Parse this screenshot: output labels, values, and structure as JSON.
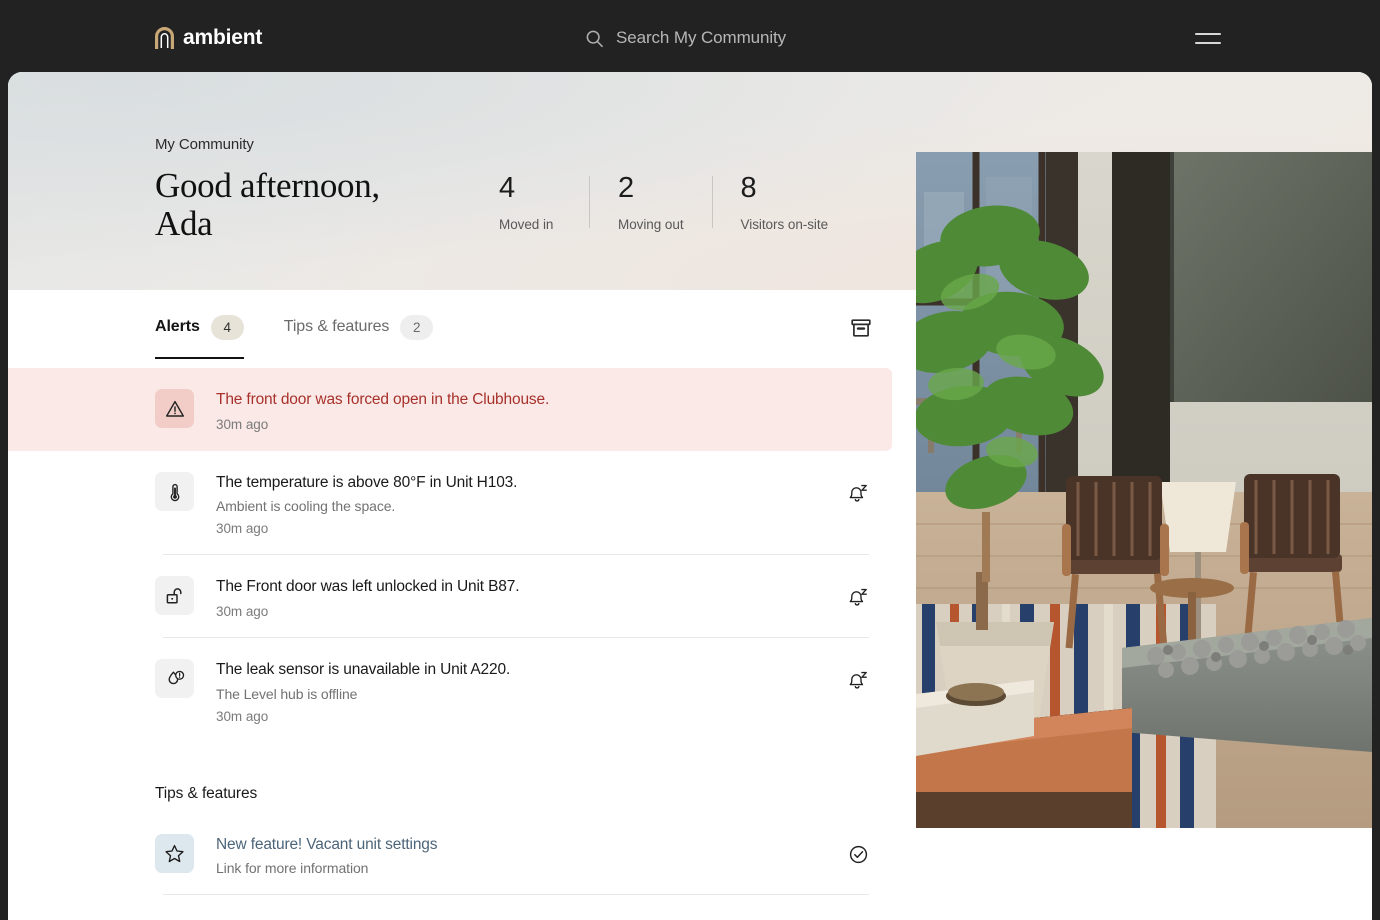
{
  "topbar": {
    "logo_icon": "arch-logo-icon",
    "brand_name": "ambient",
    "search": {
      "icon": "search-icon",
      "placeholder": "Search My Community"
    },
    "menu_icon": "hamburger-menu-icon"
  },
  "hero": {
    "community_label": "My Community",
    "greeting": "Good afternoon,\nAda",
    "stats": [
      {
        "value": "4",
        "label": "Moved in"
      },
      {
        "value": "2",
        "label": "Moving out"
      },
      {
        "value": "8",
        "label": "Visitors on-site"
      }
    ],
    "photo_alt": "community-lounge-photo"
  },
  "tabs": [
    {
      "label": "Alerts",
      "badge": "4",
      "active": true
    },
    {
      "label": "Tips & features",
      "badge": "2",
      "active": false
    }
  ],
  "archive_icon": "archive-box-icon",
  "alerts": [
    {
      "icon": "warning-triangle-icon",
      "title": "The front door was forced open in the Clubhouse.",
      "sub": "",
      "time": "30m ago",
      "severity": "critical",
      "action_icon": ""
    },
    {
      "icon": "thermometer-icon",
      "title": "The temperature is above 80°F in Unit H103.",
      "sub": "Ambient is cooling the space.",
      "time": "30m ago",
      "severity": "normal",
      "action_icon": "bell-snooze-icon"
    },
    {
      "icon": "unlocked-padlock-icon",
      "title": "The Front door was left unlocked in Unit B87.",
      "sub": "",
      "time": "30m ago",
      "severity": "normal",
      "action_icon": "bell-snooze-icon"
    },
    {
      "icon": "water-drop-alert-icon",
      "title": "The leak sensor is unavailable in Unit A220.",
      "sub": "The Level hub is offline",
      "time": "30m ago",
      "severity": "normal",
      "action_icon": "bell-snooze-icon"
    }
  ],
  "tips_section": {
    "heading": "Tips & features",
    "items": [
      {
        "icon": "star-icon",
        "title": "New feature! Vacant unit settings",
        "sub": "Link for more information",
        "action_icon": "check-circle-icon"
      }
    ]
  },
  "colors": {
    "topbar_bg": "#222222",
    "critical_bg": "#fae9e7",
    "critical_text": "#a8312b",
    "tip_text": "#4d6579",
    "accent_badge": "#e8e3d9",
    "logo_gold": "#c9a877"
  }
}
